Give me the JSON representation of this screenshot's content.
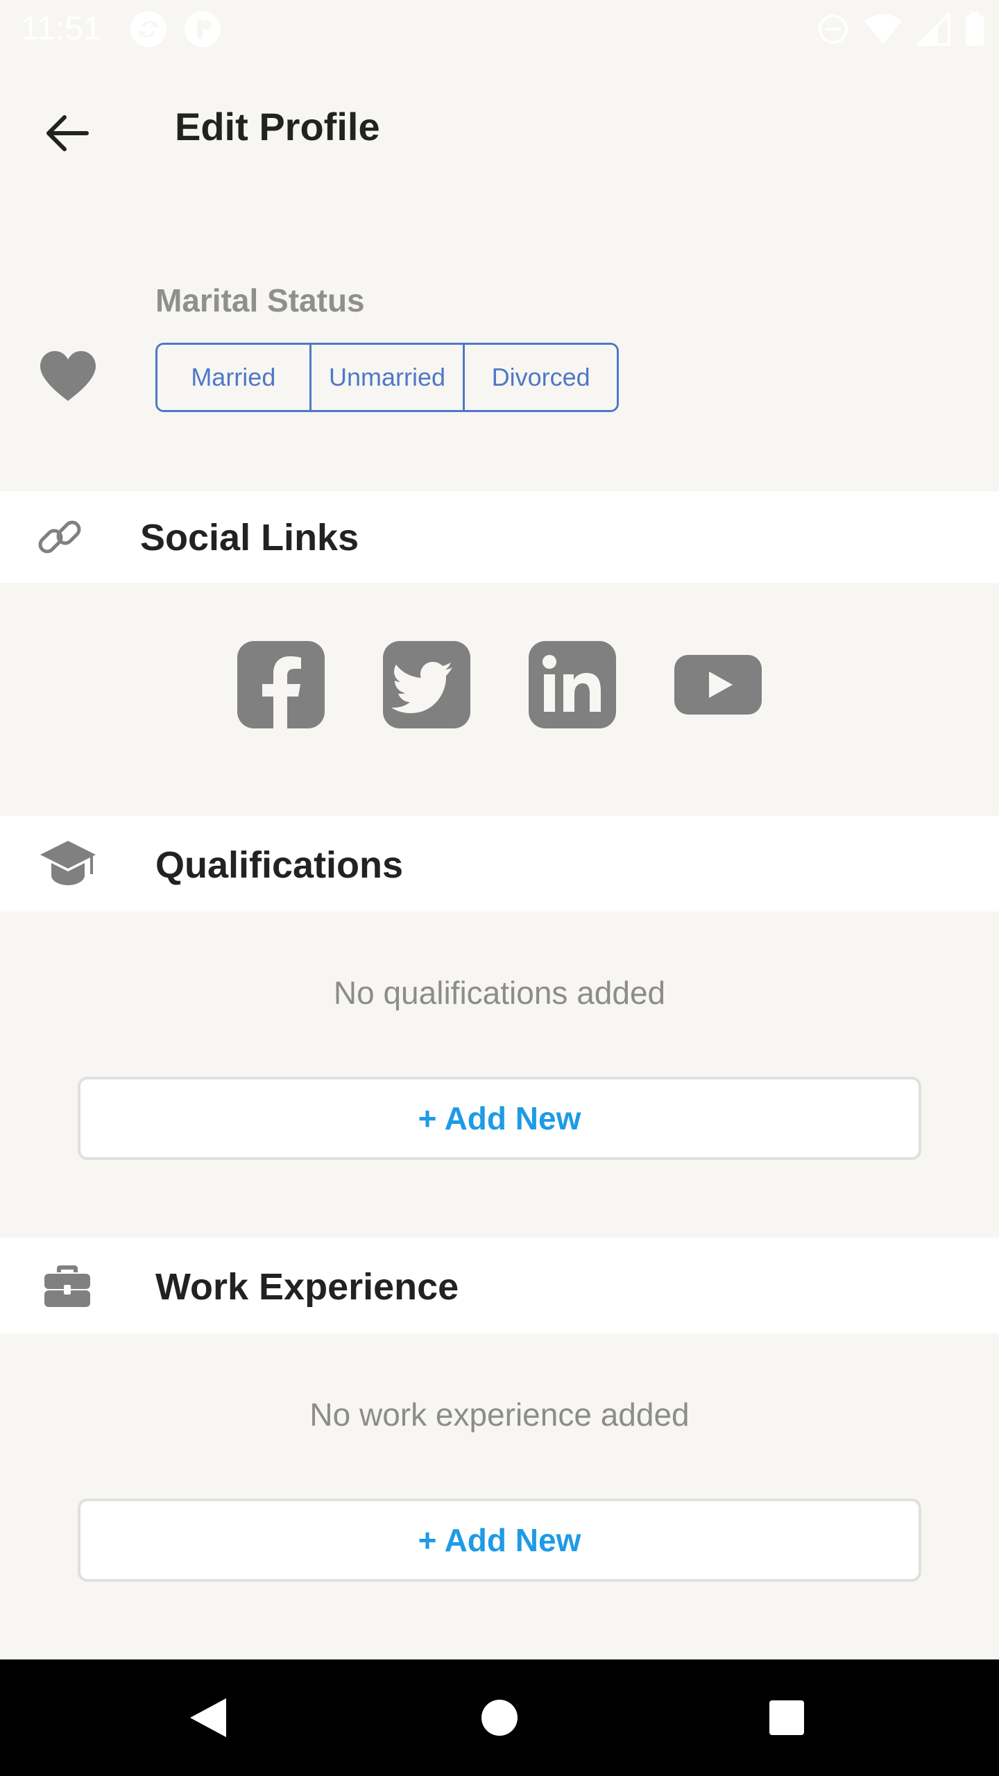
{
  "status_bar": {
    "time": "11:51"
  },
  "header": {
    "title": "Edit Profile"
  },
  "marital": {
    "label": "Marital Status",
    "options": [
      "Married",
      "Unmarried",
      "Divorced"
    ]
  },
  "social": {
    "title": "Social Links",
    "icons": [
      "facebook-icon",
      "twitter-icon",
      "linkedin-icon",
      "youtube-icon"
    ]
  },
  "qualifications": {
    "title": "Qualifications",
    "empty": "No qualifications added",
    "add_label": "+ Add New"
  },
  "work": {
    "title": "Work Experience",
    "empty": "No work experience added",
    "add_label": "+ Add New"
  },
  "colors": {
    "background": "#f7f6f3",
    "accent_segment": "#4f78c6",
    "accent_link": "#1e9be5",
    "icon_gray": "#808080"
  }
}
